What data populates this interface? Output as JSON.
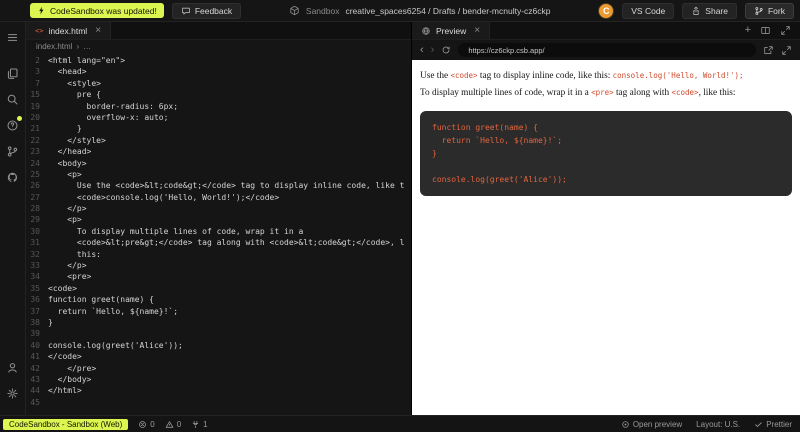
{
  "topbar": {
    "update_badge": "CodeSandbox was updated!",
    "feedback": "Feedback",
    "sandbox_label": "Sandbox",
    "project_path": "creative_spaces6254 / Drafts / bender-mcnulty-cz6ckp",
    "avatar_initial": "C",
    "vscode_button": "VS Code",
    "share_button": "Share",
    "fork_button": "Fork"
  },
  "editor": {
    "tab_label": "index.html",
    "breadcrumb_file": "index.html",
    "breadcrumb_more": "…",
    "lines": [
      {
        "n": "2",
        "t": "<html lang=\"en\">"
      },
      {
        "n": "3",
        "t": "  <head>"
      },
      {
        "n": "7",
        "t": "    <style>"
      },
      {
        "n": "15",
        "t": "      pre {"
      },
      {
        "n": "19",
        "t": "        border-radius: 6px;"
      },
      {
        "n": "20",
        "t": "        overflow-x: auto;"
      },
      {
        "n": "21",
        "t": "      }"
      },
      {
        "n": "22",
        "t": "    </style>"
      },
      {
        "n": "23",
        "t": "  </head>"
      },
      {
        "n": "24",
        "t": "  <body>"
      },
      {
        "n": "25",
        "t": "    <p>"
      },
      {
        "n": "26",
        "t": "      Use the <code>&lt;code&gt;</code> tag to display inline code, like t"
      },
      {
        "n": "27",
        "t": "      <code>console.log('Hello, World!');</code>"
      },
      {
        "n": "28",
        "t": "    </p>"
      },
      {
        "n": "29",
        "t": "    <p>"
      },
      {
        "n": "30",
        "t": "      To display multiple lines of code, wrap it in a"
      },
      {
        "n": "31",
        "t": "      <code>&lt;pre&gt;</code> tag along with <code>&lt;code&gt;</code>, l"
      },
      {
        "n": "32",
        "t": "      this:"
      },
      {
        "n": "33",
        "t": "    </p>"
      },
      {
        "n": "34",
        "t": "    <pre>"
      },
      {
        "n": "35",
        "t": "<code>"
      },
      {
        "n": "36",
        "t": "function greet(name) {"
      },
      {
        "n": "37",
        "t": "  return `Hello, ${name}!`;"
      },
      {
        "n": "38",
        "t": "}"
      },
      {
        "n": "39",
        "t": ""
      },
      {
        "n": "40",
        "t": "console.log(greet('Alice'));"
      },
      {
        "n": "41",
        "t": "</code>"
      },
      {
        "n": "42",
        "t": "    </pre>"
      },
      {
        "n": "43",
        "t": "  </body>"
      },
      {
        "n": "44",
        "t": "</html>"
      },
      {
        "n": "45",
        "t": ""
      }
    ]
  },
  "preview": {
    "tab_label": "Preview",
    "url": "https://cz6ckp.csb.app/",
    "paragraph1": [
      {
        "t": "Use the ",
        "code": false
      },
      {
        "t": "<code>",
        "code": true
      },
      {
        "t": " tag to display inline code, like this: ",
        "code": false
      },
      {
        "t": "console.log('Hello, World!');",
        "code": true
      }
    ],
    "paragraph2": [
      {
        "t": "To display multiple lines of code, wrap it in a ",
        "code": false
      },
      {
        "t": "<pre>",
        "code": true
      },
      {
        "t": " tag along with ",
        "code": false
      },
      {
        "t": "<code>",
        "code": true
      },
      {
        "t": ", like this:",
        "code": false
      }
    ],
    "code_block": [
      "function greet(name) {",
      "  return `Hello, ${name}!`;",
      "}",
      "",
      "console.log(greet('Alice'));"
    ]
  },
  "statusbar": {
    "app_badge": "CodeSandbox - Sandbox (Web)",
    "error_count": "0",
    "warning_count": "0",
    "port_count": "1",
    "open_preview": "Open preview",
    "layout": "Layout: U.S.",
    "prettier": "Prettier"
  },
  "colors": {
    "brand_yellow": "#dcf551",
    "avatar_orange": "#eb9b33",
    "inline_code_red": "#cf4a2e",
    "code_block_bg": "#2b2b2b",
    "code_block_text": "#e0653f",
    "file_icon_orange": "#e5663c"
  }
}
